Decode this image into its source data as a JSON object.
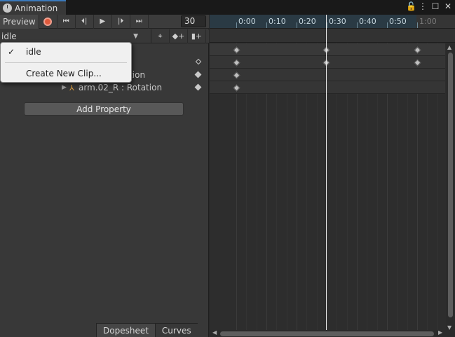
{
  "window": {
    "tab_title": "Animation",
    "controls": [
      "lock-icon",
      "more-icon",
      "maximize-icon",
      "close-icon"
    ],
    "lock_glyph": "🔓",
    "more_glyph": "⋮",
    "max_glyph": "☐",
    "close_glyph": "✕"
  },
  "toolbar": {
    "preview_label": "Preview",
    "first_key_glyph": "⏮",
    "prev_key_glyph": "⏴|",
    "play_glyph": "▶",
    "next_key_glyph": "|⏵",
    "last_key_glyph": "⏭",
    "frame_value": "30"
  },
  "clipbar": {
    "current_clip": "idle",
    "dropdown_glyph": "▼",
    "filter_glyph": "⌖",
    "add_key_glyph": "◆+",
    "add_event_glyph": "▮+"
  },
  "properties": [
    {
      "label": "tation",
      "key_style": "filled"
    },
    {
      "label": "arm.02_R : Rotation",
      "key_style": "filled"
    }
  ],
  "add_property_label": "Add Property",
  "bottom_tabs": {
    "dopesheet": "Dopesheet",
    "curves": "Curves"
  },
  "ruler": {
    "labels": [
      "0:00",
      "0:10",
      "0:20",
      "0:30",
      "0:40",
      "0:50",
      "1:00"
    ]
  },
  "dropdown": {
    "items": [
      {
        "label": "idle",
        "checked": true,
        "check_glyph": "✓"
      },
      {
        "label": "Create New Clip..."
      }
    ]
  },
  "colors": {
    "record_button": "#e05a3c",
    "accent_tab": "#3a79bb",
    "ruler_bg": "#2a3a44"
  }
}
